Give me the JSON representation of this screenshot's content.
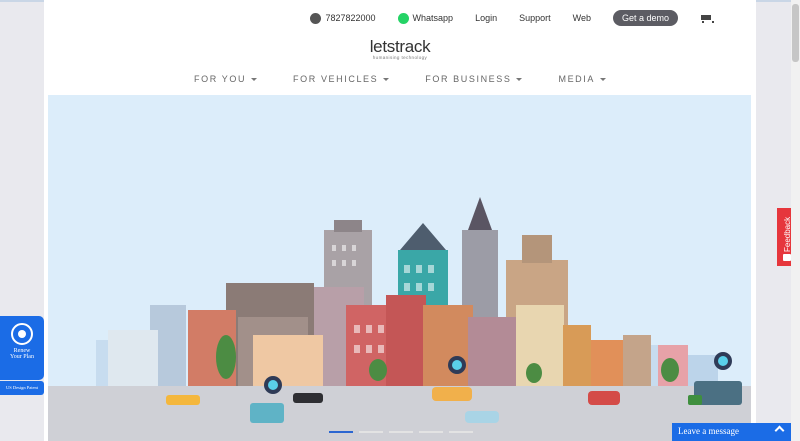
{
  "topnav": {
    "phone": "7827822000",
    "whatsapp": "Whatsapp",
    "login": "Login",
    "support": "Support",
    "web": "Web",
    "demo": "Get a demo"
  },
  "logo": {
    "word": "letstrack",
    "tagline": "humanising technology"
  },
  "mainnav": [
    {
      "label": "FOR YOU"
    },
    {
      "label": "FOR VEHICLES"
    },
    {
      "label": "FOR BUSINESS"
    },
    {
      "label": "MEDIA"
    }
  ],
  "slider": {
    "slide_count": 5,
    "active": 1
  },
  "renew": {
    "line1": "Renew",
    "line2": "Your Plan",
    "patent": "US Design Patent"
  },
  "feedback": {
    "label": "Feedback"
  },
  "chat": {
    "label": "Leave a message"
  },
  "colors": {
    "accent": "#1b6ce6",
    "feedback": "#e6363c",
    "demo_button": "#5c5c63",
    "sky": "#dcedfa"
  }
}
